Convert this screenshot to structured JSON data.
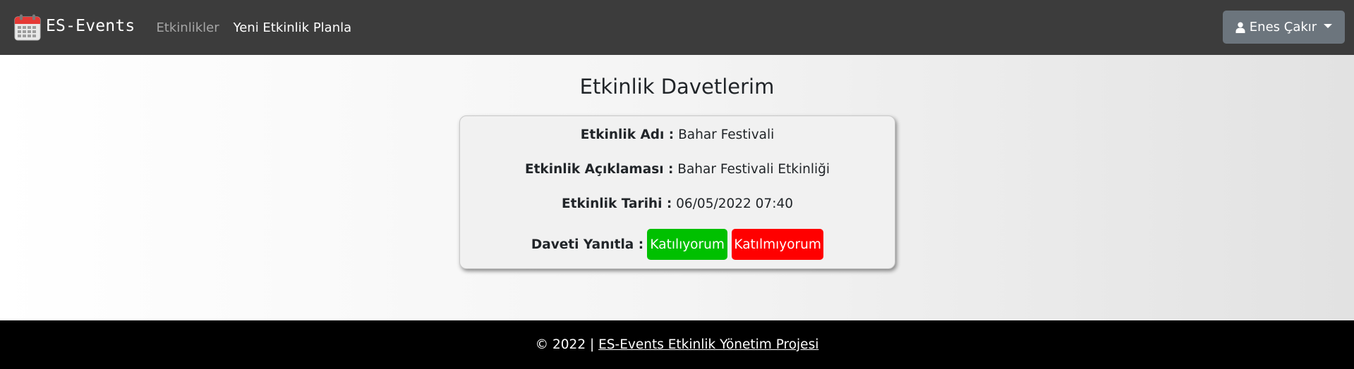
{
  "navbar": {
    "brand_text": "ES-Events",
    "brand_icon": "calendar-icon",
    "links": [
      {
        "label": "Etkinlikler"
      },
      {
        "label": "Yeni Etkinlik Planla"
      }
    ],
    "user_menu": {
      "label": "Enes Çakır",
      "icon": "user-icon"
    }
  },
  "main": {
    "title": "Etkinlik Davetlerim",
    "invitation": {
      "name_label": "Etkinlik Adı :",
      "name_value": "Bahar Festivali",
      "description_label": "Etkinlik Açıklaması :",
      "description_value": "Bahar Festivali Etkinliği",
      "date_label": "Etkinlik Tarihi :",
      "date_value": "06/05/2022 07:40",
      "reply_label": "Daveti Yanıtla :",
      "accept_label": "Katılıyorum",
      "decline_label": "Katılmıyorum"
    }
  },
  "footer": {
    "copyright": "© 2022 |",
    "link_text": "ES-Events Etkinlik Yönetim Projesi"
  },
  "colors": {
    "navbar_bg": "#3c3c3c",
    "user_button_bg": "#6c757d",
    "accept_bg": "#00c000",
    "decline_bg": "#ff0000",
    "footer_bg": "#000000"
  }
}
